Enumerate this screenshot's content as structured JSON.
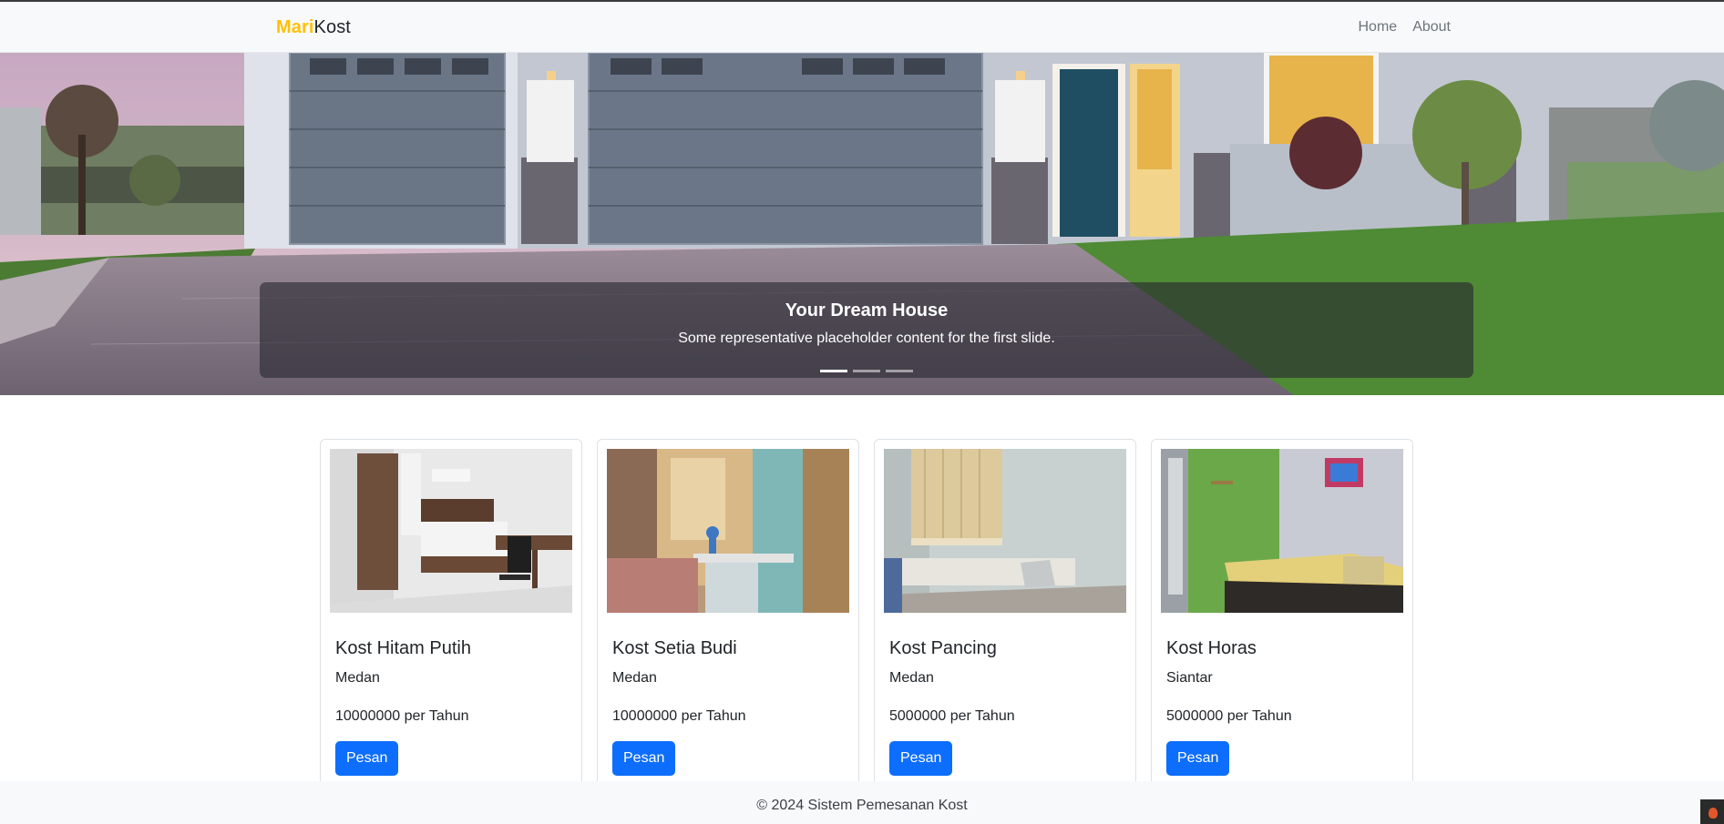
{
  "brand": {
    "part1": "Mari",
    "part2": "Kost"
  },
  "nav": {
    "home": "Home",
    "about": "About"
  },
  "hero": {
    "title": "Your Dream House",
    "text": "Some representative placeholder content for the first slide.",
    "slides_count": 3,
    "active_slide": 1
  },
  "kosts": [
    {
      "name": "Kost Hitam Putih",
      "city": "Medan",
      "price": "10000000 per Tahun",
      "button": "Pesan"
    },
    {
      "name": "Kost Setia Budi",
      "city": "Medan",
      "price": "10000000 per Tahun",
      "button": "Pesan"
    },
    {
      "name": "Kost Pancing",
      "city": "Medan",
      "price": "5000000 per Tahun",
      "button": "Pesan"
    },
    {
      "name": "Kost Horas",
      "city": "Siantar",
      "price": "5000000 per Tahun",
      "button": "Pesan"
    }
  ],
  "footer": {
    "text": "© 2024 Sistem Pemesanan Kost"
  },
  "colors": {
    "brand_accent": "#ffc107",
    "primary": "#0d6efd"
  }
}
